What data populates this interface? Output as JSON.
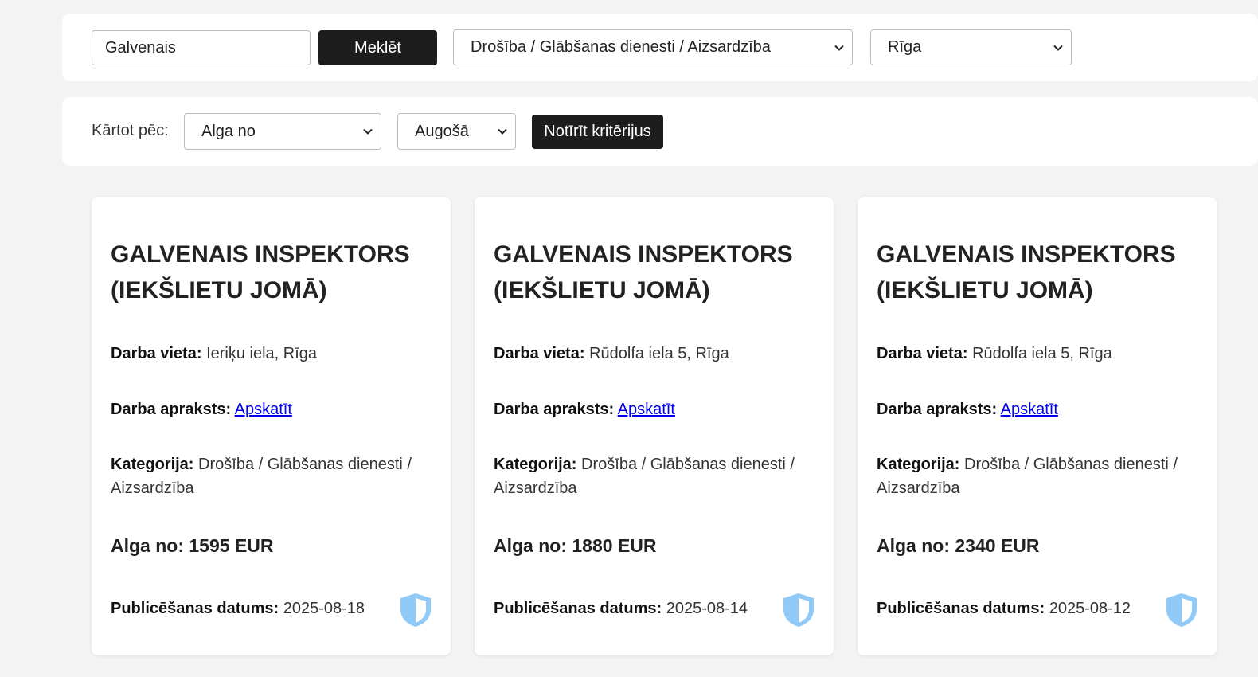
{
  "search": {
    "value": "Galvenais",
    "button_label": "Meklēt",
    "category_selected": "Drošība / Glābšanas dienesti / Aizsardzība",
    "city_selected": "Rīga"
  },
  "sort": {
    "label": "Kārtot pēc:",
    "field_selected": "Alga no",
    "order_selected": "Augošā",
    "clear_label": "Notīrīt kritērijus"
  },
  "labels": {
    "place": "Darba vieta:",
    "description": "Darba apraksts:",
    "description_link": "Apskatīt",
    "category": "Kategorija:",
    "salary": "Alga no:",
    "date": "Publicēšanas datums:"
  },
  "icons": {
    "shield": "shield-icon",
    "shield_color": "#90caf9"
  },
  "jobs": [
    {
      "title": "GALVENAIS INSPEKTORS (IEKŠLIETU JOMĀ)",
      "place": "Ieriķu iela, Rīga",
      "category": "Drošība / Glābšanas dienesti / Aizsardzība",
      "salary": "1595 EUR",
      "date": "2025-08-18"
    },
    {
      "title": "GALVENAIS INSPEKTORS (IEKŠLIETU JOMĀ)",
      "place": "Rūdolfa iela 5, Rīga",
      "category": "Drošība / Glābšanas dienesti / Aizsardzība",
      "salary": "1880 EUR",
      "date": "2025-08-14"
    },
    {
      "title": "GALVENAIS INSPEKTORS (IEKŠLIETU JOMĀ)",
      "place": "Rūdolfa iela 5, Rīga",
      "category": "Drošība / Glābšanas dienesti / Aizsardzība",
      "salary": "2340 EUR",
      "date": "2025-08-12"
    }
  ]
}
